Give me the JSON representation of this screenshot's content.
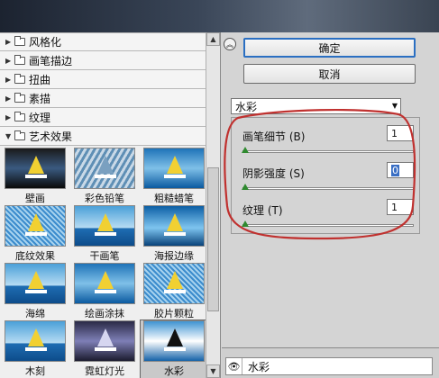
{
  "dialog": {
    "ok_label": "确定",
    "cancel_label": "取消",
    "collapse_icon": "double-chevron-up-icon"
  },
  "categories": [
    {
      "label": "风格化",
      "expanded": false
    },
    {
      "label": "画笔描边",
      "expanded": false
    },
    {
      "label": "扭曲",
      "expanded": false
    },
    {
      "label": "素描",
      "expanded": false
    },
    {
      "label": "纹理",
      "expanded": false
    },
    {
      "label": "艺术效果",
      "expanded": true
    }
  ],
  "thumbnails": [
    {
      "label": "壁画",
      "selected": false
    },
    {
      "label": "彩色铅笔",
      "selected": false
    },
    {
      "label": "粗糙蜡笔",
      "selected": false
    },
    {
      "label": "底纹效果",
      "selected": false
    },
    {
      "label": "干画笔",
      "selected": false
    },
    {
      "label": "海报边缘",
      "selected": false
    },
    {
      "label": "海绵",
      "selected": false
    },
    {
      "label": "绘画涂抹",
      "selected": false
    },
    {
      "label": "胶片颗粒",
      "selected": false
    },
    {
      "label": "木刻",
      "selected": false
    },
    {
      "label": "霓虹灯光",
      "selected": false
    },
    {
      "label": "水彩",
      "selected": true
    }
  ],
  "filter_select": {
    "value": "水彩"
  },
  "params": [
    {
      "label": "画笔细节 (B)",
      "value": "1",
      "level": 0.0
    },
    {
      "label": "阴影强度 (S)",
      "value": "0",
      "level": 0.0
    },
    {
      "label": "纹理 (T)",
      "value": "1",
      "level": 0.0
    }
  ],
  "layers": [
    {
      "name": "水彩",
      "visible": true
    }
  ],
  "colors": {
    "annotation": "#c0312f",
    "focus": "#2a6fc2",
    "slider_thumb": "#2f8a2f"
  }
}
